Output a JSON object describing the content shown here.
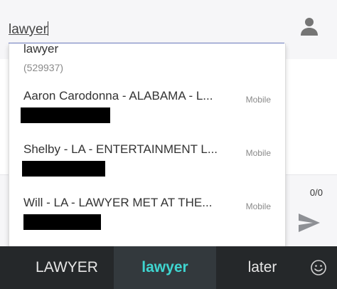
{
  "recipient": {
    "value": "lawyer"
  },
  "compose": {
    "char_count": "0/0"
  },
  "suggestions": {
    "term": {
      "label": "lawyer",
      "count": "(529937)"
    },
    "contacts": [
      {
        "name": "Aaron Carodonna - ALABAMA - L...",
        "type": "Mobile"
      },
      {
        "name": "Shelby - LA - ENTERTAINMENT L...",
        "type": "Mobile"
      },
      {
        "name": "Will - LA - LAWYER MET AT THE...",
        "type": "Mobile"
      }
    ]
  },
  "keyboard": {
    "suggestions": [
      {
        "label": "LAWYER",
        "selected": false
      },
      {
        "label": "lawyer",
        "selected": true
      },
      {
        "label": "later",
        "selected": false
      }
    ]
  },
  "icons": {
    "contact": "person-icon",
    "send": "send-icon",
    "emoji": "smiley-icon"
  },
  "colors": {
    "accent": "#3fd5d0",
    "input_underline": "#6f7ec2",
    "keyboard_bg": "#25282a",
    "redaction": "#000000"
  }
}
